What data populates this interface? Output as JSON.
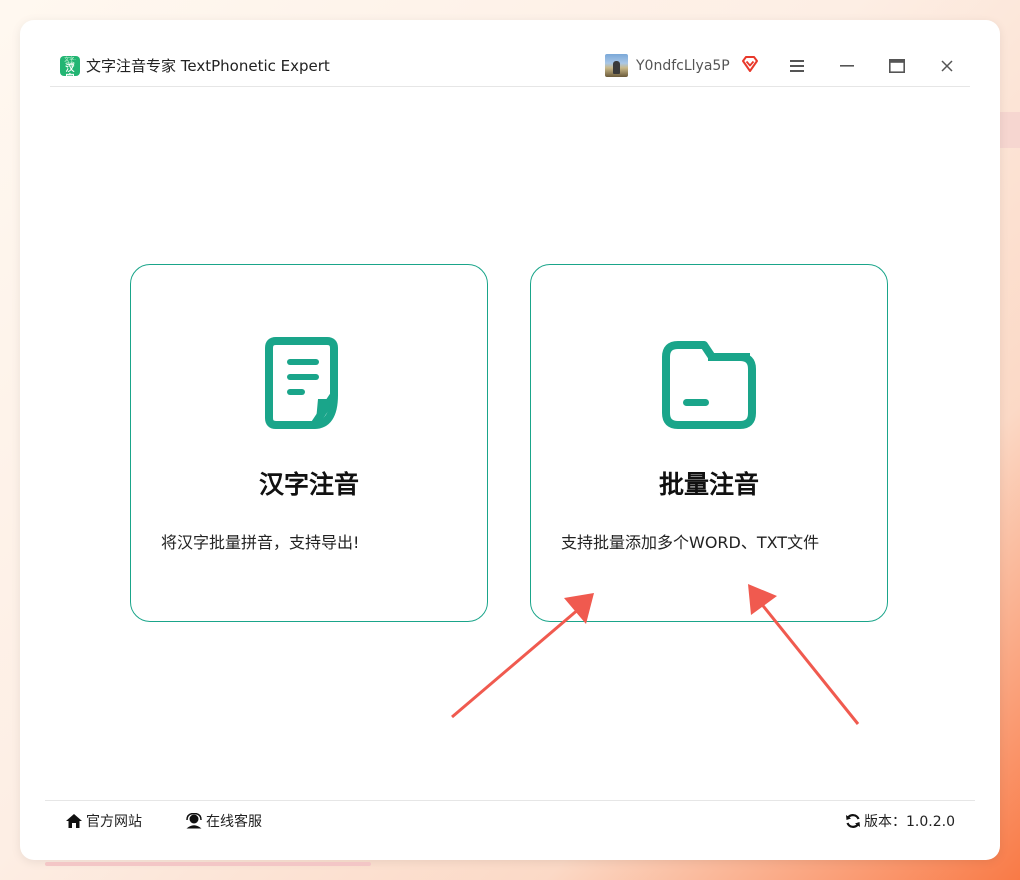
{
  "app": {
    "logo_top": "文字·注音",
    "logo_main": "汉字",
    "title": "文字注音专家 TextPhonetic Expert"
  },
  "user": {
    "name": "Y0ndfcLlya5P"
  },
  "cards": [
    {
      "title": "汉字注音",
      "desc": "将汉字批量拼音，支持导出!",
      "icon": "document-icon"
    },
    {
      "title": "批量注音",
      "desc": "支持批量添加多个WORD、TXT文件",
      "icon": "folder-icon"
    }
  ],
  "footer": {
    "website": "官方网站",
    "support": "在线客服",
    "version": "版本：1.0.2.0"
  },
  "colors": {
    "accent": "#1aa58a",
    "arrow": "#f05a4f"
  }
}
